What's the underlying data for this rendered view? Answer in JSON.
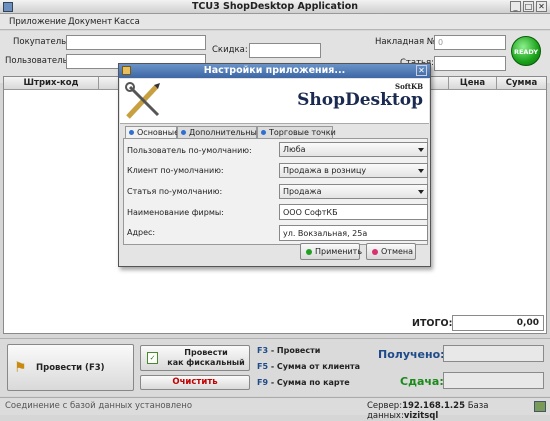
{
  "window": {
    "title": "TCU3 ShopDesktop Application",
    "min": "_",
    "max": "□",
    "close": "✕"
  },
  "menu": [
    "Приложение",
    "Документ",
    "Касса"
  ],
  "form": {
    "buyer_label": "Покупатель:",
    "buyer_value": "",
    "user_label": "Пользователь:",
    "user_value": "",
    "discount_label": "Скидка:",
    "discount_value": "",
    "invoice_label": "Накладная №:",
    "invoice_value": "0",
    "article_label": "Статья:",
    "ready": "READY"
  },
  "table": {
    "columns": [
      "Штрих-код",
      "Цена",
      "Сумма"
    ]
  },
  "totals": {
    "label": "ИТОГО:",
    "value": "0,00"
  },
  "actions": {
    "post": "Провести (F3)",
    "fiscal_line1": "Провести",
    "fiscal_line2": "как фискальный",
    "clear": "Очистить"
  },
  "hotkeys": [
    {
      "key": "F3",
      "text": "- Провести"
    },
    {
      "key": "F5",
      "text": "- Сумма от клиента"
    },
    {
      "key": "F9",
      "text": "- Сумма по карте"
    }
  ],
  "payment": {
    "received_label": "Получено:",
    "change_label": "Сдача:"
  },
  "status": {
    "left": "Соединение с базой данных установлено",
    "server_label": "Сервер:",
    "server": "192.168.1.25",
    "db_label": "База данных:",
    "db": "vizitsql"
  },
  "dialog": {
    "title": "Настройки приложения...",
    "close": "✕",
    "brand": "ShopDesktop",
    "brand_small": "SoftKB",
    "tabs": [
      "Основные",
      "Дополнительные",
      "Торговые точки"
    ],
    "fields": [
      {
        "label": "Пользователь по-умолчанию:",
        "value": "Люба"
      },
      {
        "label": "Клиент по-умолчанию:",
        "value": "Продажа в розницу"
      },
      {
        "label": "Статья по-умолчанию:",
        "value": "Продажа"
      },
      {
        "label": "Наименование фирмы:",
        "value": "ООО СофтКБ"
      },
      {
        "label": "Адрес:",
        "value": "ул. Вокзальная, 25а"
      }
    ],
    "apply": "Применить",
    "cancel": "Отмена"
  },
  "colors": {
    "accent": "#3d67a3",
    "ready": "#1aa21a",
    "total_label": "#1e4a8a",
    "received": "#1e4a8a",
    "change": "#1a8a1a",
    "clear": "#c00000"
  }
}
